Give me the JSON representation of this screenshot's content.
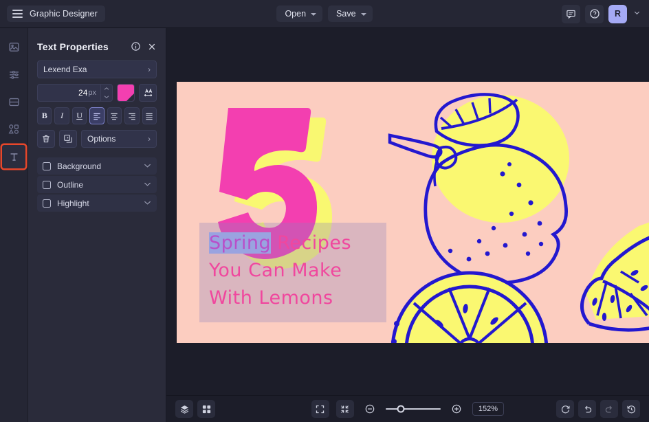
{
  "header": {
    "app_title": "Graphic Designer",
    "menu_icon": "hamburger-icon",
    "open_label": "Open",
    "save_label": "Save",
    "comment_icon": "comment-icon",
    "help_icon": "help-circle-icon",
    "avatar_initial": "R",
    "avatar_color": "#a5aaf5"
  },
  "rail": {
    "items": [
      {
        "name": "image-tool",
        "icon": "image-icon",
        "active": false
      },
      {
        "name": "adjust-tool",
        "icon": "sliders-icon",
        "active": false
      },
      {
        "name": "layout-tool",
        "icon": "layout-icon",
        "active": false
      },
      {
        "name": "shapes-tool",
        "icon": "shapes-icon",
        "active": false
      },
      {
        "name": "text-tool",
        "icon": "text-t-icon",
        "active": true
      }
    ],
    "highlight_color": "#e8472a"
  },
  "panel": {
    "title": "Text Properties",
    "info_icon": "info-circle-icon",
    "close_icon": "close-x-icon",
    "font_family": "Lexend Exa",
    "font_size_value": "24",
    "font_size_unit": "px",
    "text_color": "#f33fb0",
    "letter_spacing_icon": "letter-spacing-icon",
    "format_buttons": [
      {
        "name": "bold-button",
        "label": "B",
        "active": false
      },
      {
        "name": "italic-button",
        "label": "I",
        "active": false
      },
      {
        "name": "underline-button",
        "label": "U",
        "active": false
      },
      {
        "name": "align-left-button",
        "label": "align-left-icon",
        "active": true
      },
      {
        "name": "align-center-button",
        "label": "align-center-icon",
        "active": false
      },
      {
        "name": "align-right-button",
        "label": "align-right-icon",
        "active": false
      },
      {
        "name": "align-justify-button",
        "label": "align-justify-icon",
        "active": false
      }
    ],
    "delete_icon": "trash-icon",
    "duplicate_icon": "duplicate-icon",
    "options_label": "Options",
    "toggles": [
      {
        "label": "Background",
        "checked": false
      },
      {
        "label": "Outline",
        "checked": false
      },
      {
        "label": "Highlight",
        "checked": false
      }
    ]
  },
  "canvas": {
    "background_color": "#fccdc0",
    "number_badge": "5",
    "number_color": "#f33fb0",
    "number_shadow_color": "#f9f871",
    "lemon_fill": "#faf871",
    "lemon_stroke": "#2318cf",
    "text_lines": [
      {
        "selected": "Spring",
        "rest": " Recipes"
      },
      {
        "selected": "",
        "rest": "You Can Make"
      },
      {
        "selected": "",
        "rest": "With Lemons"
      }
    ],
    "text_color": "#f0479e",
    "selection_color": "#9aa3e0"
  },
  "bottombar": {
    "layers_icon": "layers-icon",
    "grid_icon": "grid-icon",
    "fit_icon": "fit-screen-icon",
    "collapse_icon": "collapse-icon",
    "zoom_out_icon": "zoom-out-icon",
    "zoom_in_icon": "zoom-in-icon",
    "zoom_level": "152%",
    "reset_icon": "reset-icon",
    "undo_icon": "undo-icon",
    "redo_icon": "redo-icon",
    "history_icon": "history-icon"
  }
}
